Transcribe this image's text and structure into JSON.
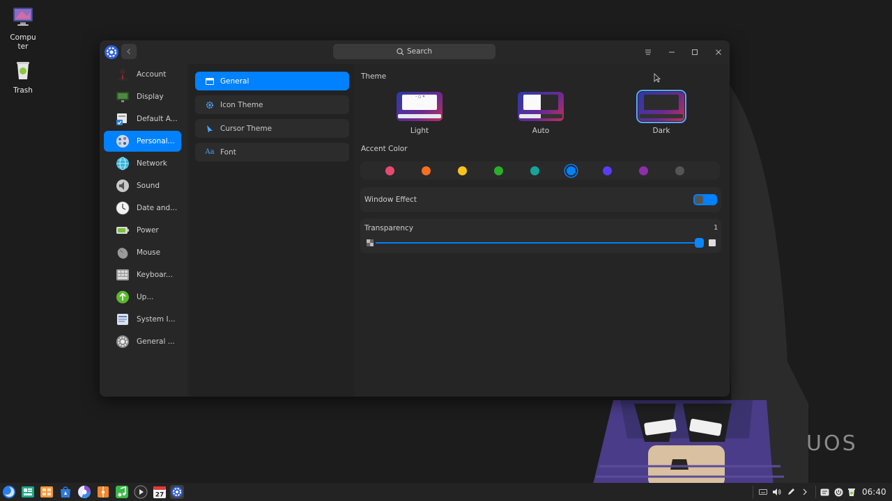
{
  "desktop": {
    "icons": [
      {
        "label": "Compu\nter",
        "icon": "computer-icon"
      },
      {
        "label": "Trash",
        "icon": "trash-icon"
      }
    ],
    "watermark": "UOS"
  },
  "window": {
    "search": {
      "placeholder": "Search"
    },
    "titlebar_icons": [
      "settings-app-icon",
      "chevron-left-icon",
      "search-icon",
      "menu-icon",
      "minimize-icon",
      "maximize-icon",
      "close-icon"
    ]
  },
  "sidebar": {
    "items": [
      {
        "label": "Account",
        "icon": "account-icon"
      },
      {
        "label": "Display",
        "icon": "display-icon"
      },
      {
        "label": "Default A...",
        "icon": "default-apps-icon"
      },
      {
        "label": "Personal...",
        "icon": "personalization-icon",
        "active": true
      },
      {
        "label": "Network",
        "icon": "network-icon"
      },
      {
        "label": "Sound",
        "icon": "sound-icon"
      },
      {
        "label": "Date and...",
        "icon": "clock-icon"
      },
      {
        "label": "Power",
        "icon": "battery-icon"
      },
      {
        "label": "Mouse",
        "icon": "mouse-icon"
      },
      {
        "label": "Keyboar...",
        "icon": "keyboard-icon"
      },
      {
        "label": "Up...",
        "icon": "update-icon"
      },
      {
        "label": "System I...",
        "icon": "system-info-icon"
      },
      {
        "label": "General ...",
        "icon": "general-settings-icon"
      }
    ]
  },
  "subnav": {
    "items": [
      {
        "label": "General",
        "icon": "window-icon",
        "active": true
      },
      {
        "label": "Icon Theme",
        "icon": "gear-icon"
      },
      {
        "label": "Cursor Theme",
        "icon": "cursor-icon"
      },
      {
        "label": "Font",
        "icon": "font-icon",
        "glyph": "Aa"
      }
    ]
  },
  "content": {
    "theme": {
      "title": "Theme",
      "options": [
        {
          "label": "Light",
          "selected": false
        },
        {
          "label": "Auto",
          "selected": false
        },
        {
          "label": "Dark",
          "selected": true
        }
      ]
    },
    "accent": {
      "title": "Accent Color",
      "colors": [
        "#e84a6f",
        "#f76f20",
        "#f8c41c",
        "#2aaf2a",
        "#14a59a",
        "#0081ff",
        "#5b3bf5",
        "#8e2ea8",
        "#555555"
      ],
      "selected_index": 5
    },
    "window_effect": {
      "label": "Window Effect",
      "enabled": true
    },
    "transparency": {
      "label": "Transparency",
      "value": "1",
      "fraction": 1.0
    }
  },
  "taskbar": {
    "apps": [
      "launcher-icon",
      "multitask-view-icon",
      "file-manager-icon",
      "app-store-icon",
      "browser-icon",
      "archive-icon",
      "music-icon",
      "video-player-icon",
      "calendar-icon",
      "control-center-icon"
    ],
    "calendar_day": "27",
    "tray": [
      "keyboard-layout-icon",
      "volume-icon",
      "pen-icon",
      "chevron-right-icon",
      "notification-icon",
      "power-icon",
      "trash-tray-icon"
    ],
    "clock": "06:40"
  },
  "colors": {
    "accent": "#0081ff",
    "window_bg": "#252525",
    "sidebar_bg": "#272727"
  }
}
